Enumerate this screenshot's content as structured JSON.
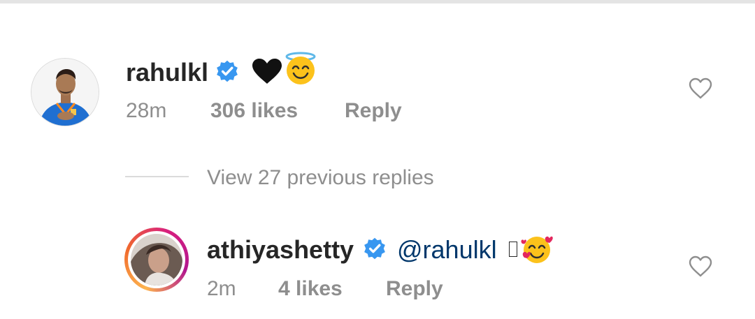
{
  "comments": [
    {
      "username": "rahulkl",
      "verified": true,
      "emojis": [
        "black-heart",
        "smiling-face-with-halo"
      ],
      "time": "28m",
      "likes": "306 likes",
      "reply_label": "Reply"
    },
    {
      "username": "athiyashetty",
      "verified": true,
      "mention": "@rahulkl",
      "emojis": [
        "missing-glyph",
        "smiling-face-with-hearts"
      ],
      "time": "2m",
      "likes": "4 likes",
      "reply_label": "Reply"
    }
  ],
  "view_replies": "View 27 previous replies",
  "colors": {
    "verified_blue": "#3897f0",
    "meta_gray": "#8e8e8e",
    "mention_blue": "#00376b"
  }
}
